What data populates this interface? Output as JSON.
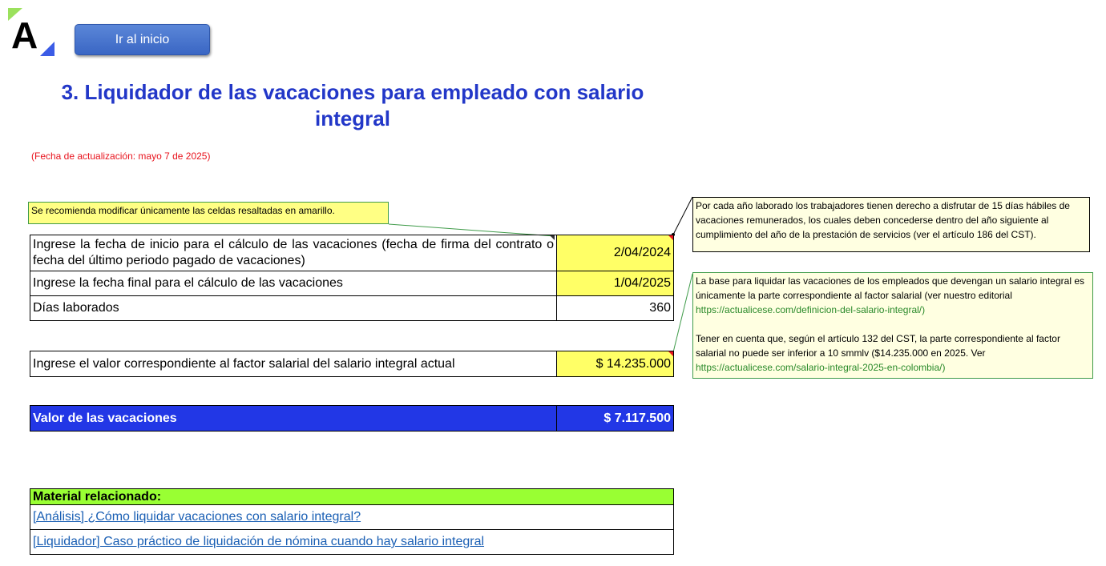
{
  "header": {
    "logo_letter": "A",
    "home_button_label": "Ir al inicio"
  },
  "title": "3. Liquidador de las vacaciones para empleado con salario integral",
  "update_date": "(Fecha de actualización: mayo 7 de 2025)",
  "hint": "Se recomienda modificar únicamente las celdas resaltadas en amarillo.",
  "inputs": {
    "start_date_label": "Ingrese la fecha de inicio para el cálculo de las vacaciones (fecha de firma del contrato o fecha del último periodo pagado de vacaciones)",
    "start_date_value": "2/04/2024",
    "end_date_label": "Ingrese la fecha final para el cálculo de las vacaciones",
    "end_date_value": "1/04/2025",
    "days_label": "Días laborados",
    "days_value": "360",
    "factor_label": "Ingrese el valor correspondiente al factor salarial del salario integral actual",
    "factor_value": "$ 14.235.000"
  },
  "result": {
    "label": "Valor de las vacaciones",
    "value": "$ 7.117.500"
  },
  "material": {
    "header": "Material relacionado:",
    "links": [
      "[Análisis] ¿Cómo liquidar vacaciones con salario integral?",
      "[Liquidador] Caso práctico de liquidación de nómina cuando hay salario integral"
    ]
  },
  "notes": {
    "note1": "Por cada año laborado los trabajadores tienen derecho a disfrutar de 15 días hábiles de vacaciones remunerados, los cuales deben concederse dentro del año siguiente al cumplimiento del año de la prestación de servicios (ver el artículo 186 del CST).",
    "note2_p1": "La base para liquidar las vacaciones de los empleados que devengan un salario integral es únicamente la parte correspondiente al factor salarial (ver nuestro editorial",
    "note2_url1": "https://actualicese.com/definicion-del-salario-integral/)",
    "note2_p2": "Tener en cuenta que, según el artículo 132 del CST, la parte correspondiente al factor salarial no puede ser inferior a 10 smmlv ($14.235.000 en 2025. Ver",
    "note2_url2": "https://actualicese.com/salario-integral-2025-en-colombia/)"
  },
  "colors": {
    "title": "#2237c8",
    "update_date": "#e8141e",
    "input_yellow": "#ffff66",
    "result_blue": "#2237e6",
    "material_green": "#99ff33",
    "note_bg": "#ffffe1",
    "link_blue": "#1a5fb4"
  },
  "icons": {
    "logo": "actualicese-logo"
  }
}
